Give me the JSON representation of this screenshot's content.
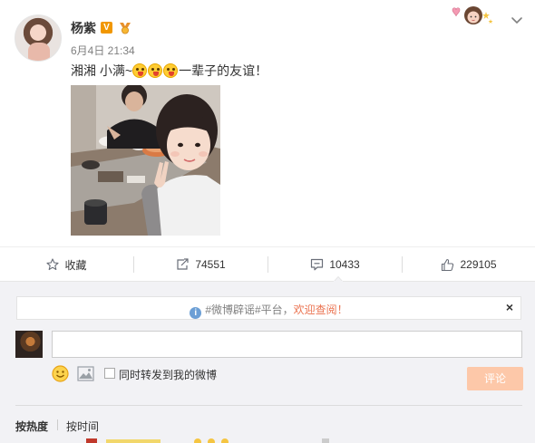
{
  "post": {
    "username": "杨紫",
    "verified_badge": "V",
    "time": "6月4日 21:34",
    "text_before_emoji": "湘湘 小满~",
    "emoji_count": 3,
    "text_after_emoji": "一辈子的友谊！",
    "icons": [
      "avatar",
      "verified-icon",
      "medal-icon",
      "emoji-icon",
      "sticker-art",
      "chevron-down-icon"
    ]
  },
  "actions": {
    "favorite_label": "收藏",
    "repost_count": "74551",
    "comment_count": "10433",
    "like_count": "229105",
    "icons": [
      "star-icon",
      "repost-icon",
      "comment-icon",
      "thumbs-up-icon"
    ]
  },
  "comment_box": {
    "notice_prefix": "#微博辟谣#平台，",
    "notice_link": "欢迎查阅！",
    "notice_close": "×",
    "input_value": "",
    "forward_label": "同时转发到我的微博",
    "submit_label": "评论",
    "icons": [
      "info-icon",
      "smiley-icon",
      "image-icon",
      "close-icon"
    ]
  },
  "sort": {
    "by_hot": "按热度",
    "by_time": "按时间"
  },
  "colors": {
    "accent_orange": "#eb7350",
    "submit_disabled": "#fdc8a9",
    "panel_bg": "#f2f2f5",
    "verified_orange": "#f19700",
    "info_blue": "#6c9fd5"
  }
}
